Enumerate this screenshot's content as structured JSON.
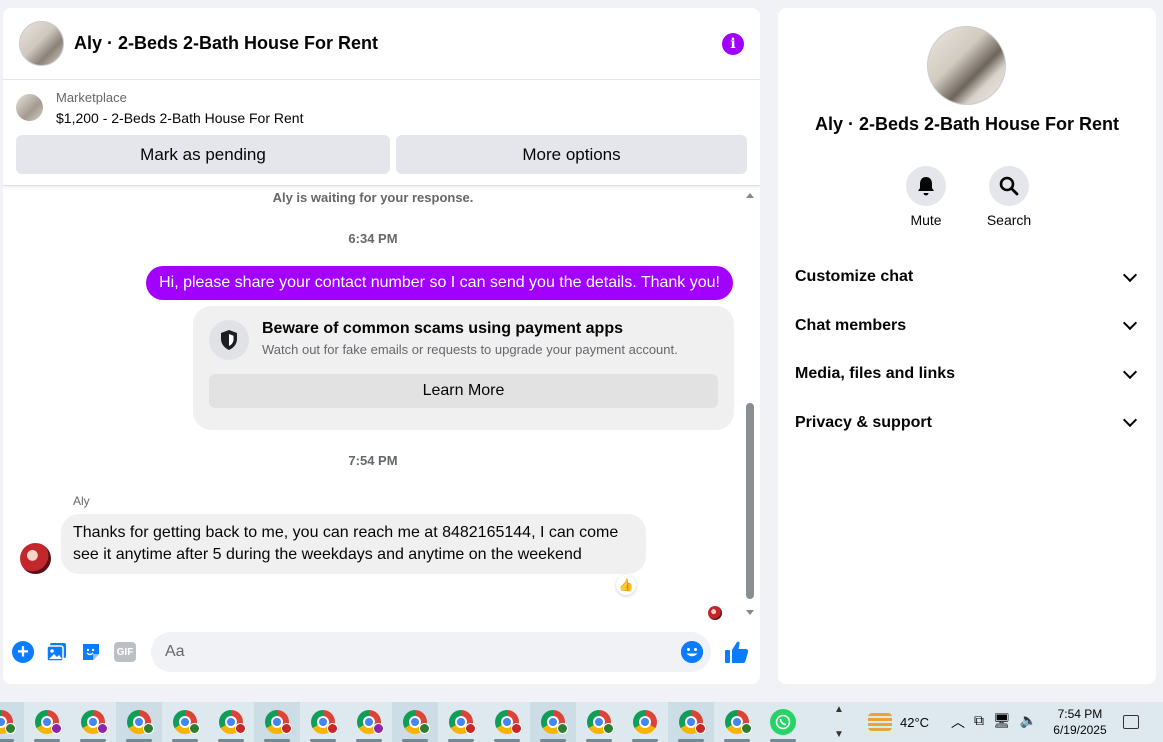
{
  "chat": {
    "title": "Aly · 2-Beds 2-Bath House For Rent",
    "marketplace_label": "Marketplace",
    "listing": "$1,200 - 2-Beds 2-Bath House For Rent",
    "mark_pending": "Mark as pending",
    "more_options": "More options",
    "waiting": "Aly is waiting for your response.",
    "time1": "6:34 PM",
    "outgoing": "Hi, please share your contact number so I can send you the details. Thank you!",
    "scam_title": "Beware of common scams using payment apps",
    "scam_sub": "Watch out for fake emails or requests to upgrade your payment account.",
    "learn_more": "Learn More",
    "time2": "7:54 PM",
    "sender": "Aly",
    "incoming": "Thanks for getting back to me, you can reach me at 8482165144, I can come see it anytime after 5 during the weekdays and anytime on the weekend",
    "reaction": "👍",
    "input_placeholder": "Aa",
    "gif": "GIF"
  },
  "info": {
    "title": "Aly · 2-Beds 2-Bath House For Rent",
    "mute": "Mute",
    "search": "Search",
    "sections": [
      "Customize chat",
      "Chat members",
      "Media, files and links",
      "Privacy & support"
    ]
  },
  "taskbar": {
    "temperature": "42°C",
    "time": "7:54 PM",
    "date": "6/19/2025"
  },
  "colors": {
    "accent": "#a200ff",
    "messenger_blue": "#0a7cff"
  }
}
